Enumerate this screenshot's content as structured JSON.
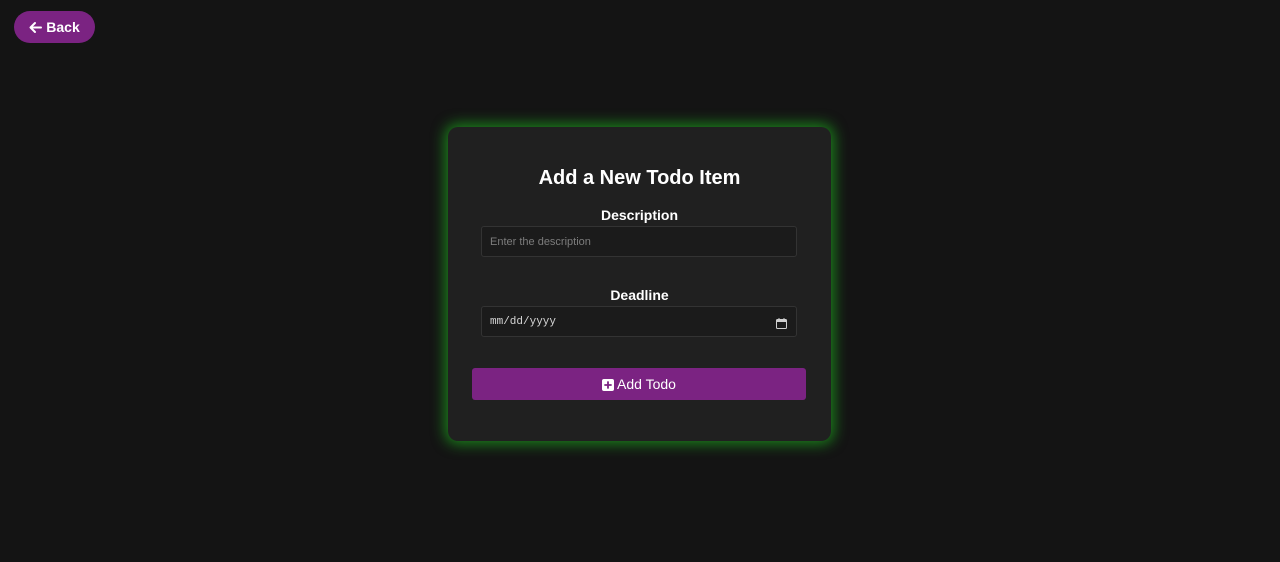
{
  "header": {
    "back_label": "Back",
    "back_icon": "arrow-left-icon"
  },
  "form": {
    "title": "Add a New Todo Item",
    "description": {
      "label": "Description",
      "placeholder": "Enter the description",
      "value": ""
    },
    "deadline": {
      "label": "Deadline",
      "display": "mm/dd/yyyy",
      "icon": "calendar-icon"
    },
    "submit": {
      "label": "Add Todo",
      "icon": "plus-square-icon"
    }
  },
  "colors": {
    "background": "#141414",
    "card": "#202020",
    "accent": "#7b2382",
    "glow": "#1eaa1e"
  }
}
